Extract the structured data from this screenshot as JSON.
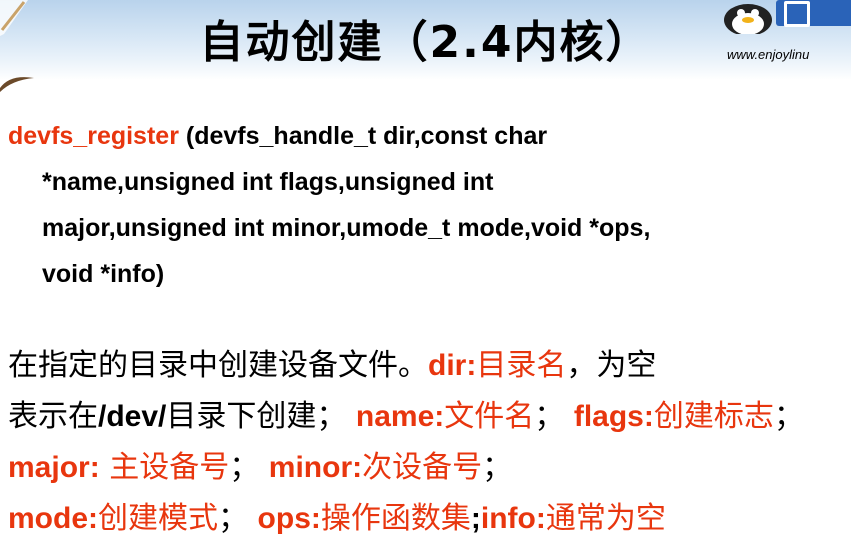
{
  "slide": {
    "title": "自动创建（2.4内核）",
    "logo_url": "www.enjoylinu"
  },
  "signature": {
    "func_name": "devfs_register",
    "line1_rest": " (devfs_handle_t dir,const char",
    "line2": "*name,unsigned int flags,unsigned int",
    "line3": "major,unsigned int minor,umode_t mode,void *ops,",
    "line4": "void *info)"
  },
  "description": {
    "d1": "在指定的目录中创建设备文件。",
    "k_dir": "dir:",
    "v_dir": "目录名",
    "d2": "，为空",
    "d3": "表示在",
    "path": "/dev/",
    "d4": "目录下创建；",
    "k_name": "name:",
    "v_name": "文件名",
    "d5": "；",
    "k_flags": "flags:",
    "v_flags": "创建标志",
    "d6": "；",
    "k_major": "major:",
    "v_major": " 主设备号",
    "d7": "；",
    "k_minor": "minor:",
    "v_minor": "次设备号",
    "d8": "；",
    "k_mode": "mode:",
    "v_mode": "创建模式",
    "d9": "；",
    "k_ops": "ops:",
    "v_ops": "操作函数集",
    "semi": ";",
    "k_info": "info:",
    "v_info": "通常为空"
  }
}
